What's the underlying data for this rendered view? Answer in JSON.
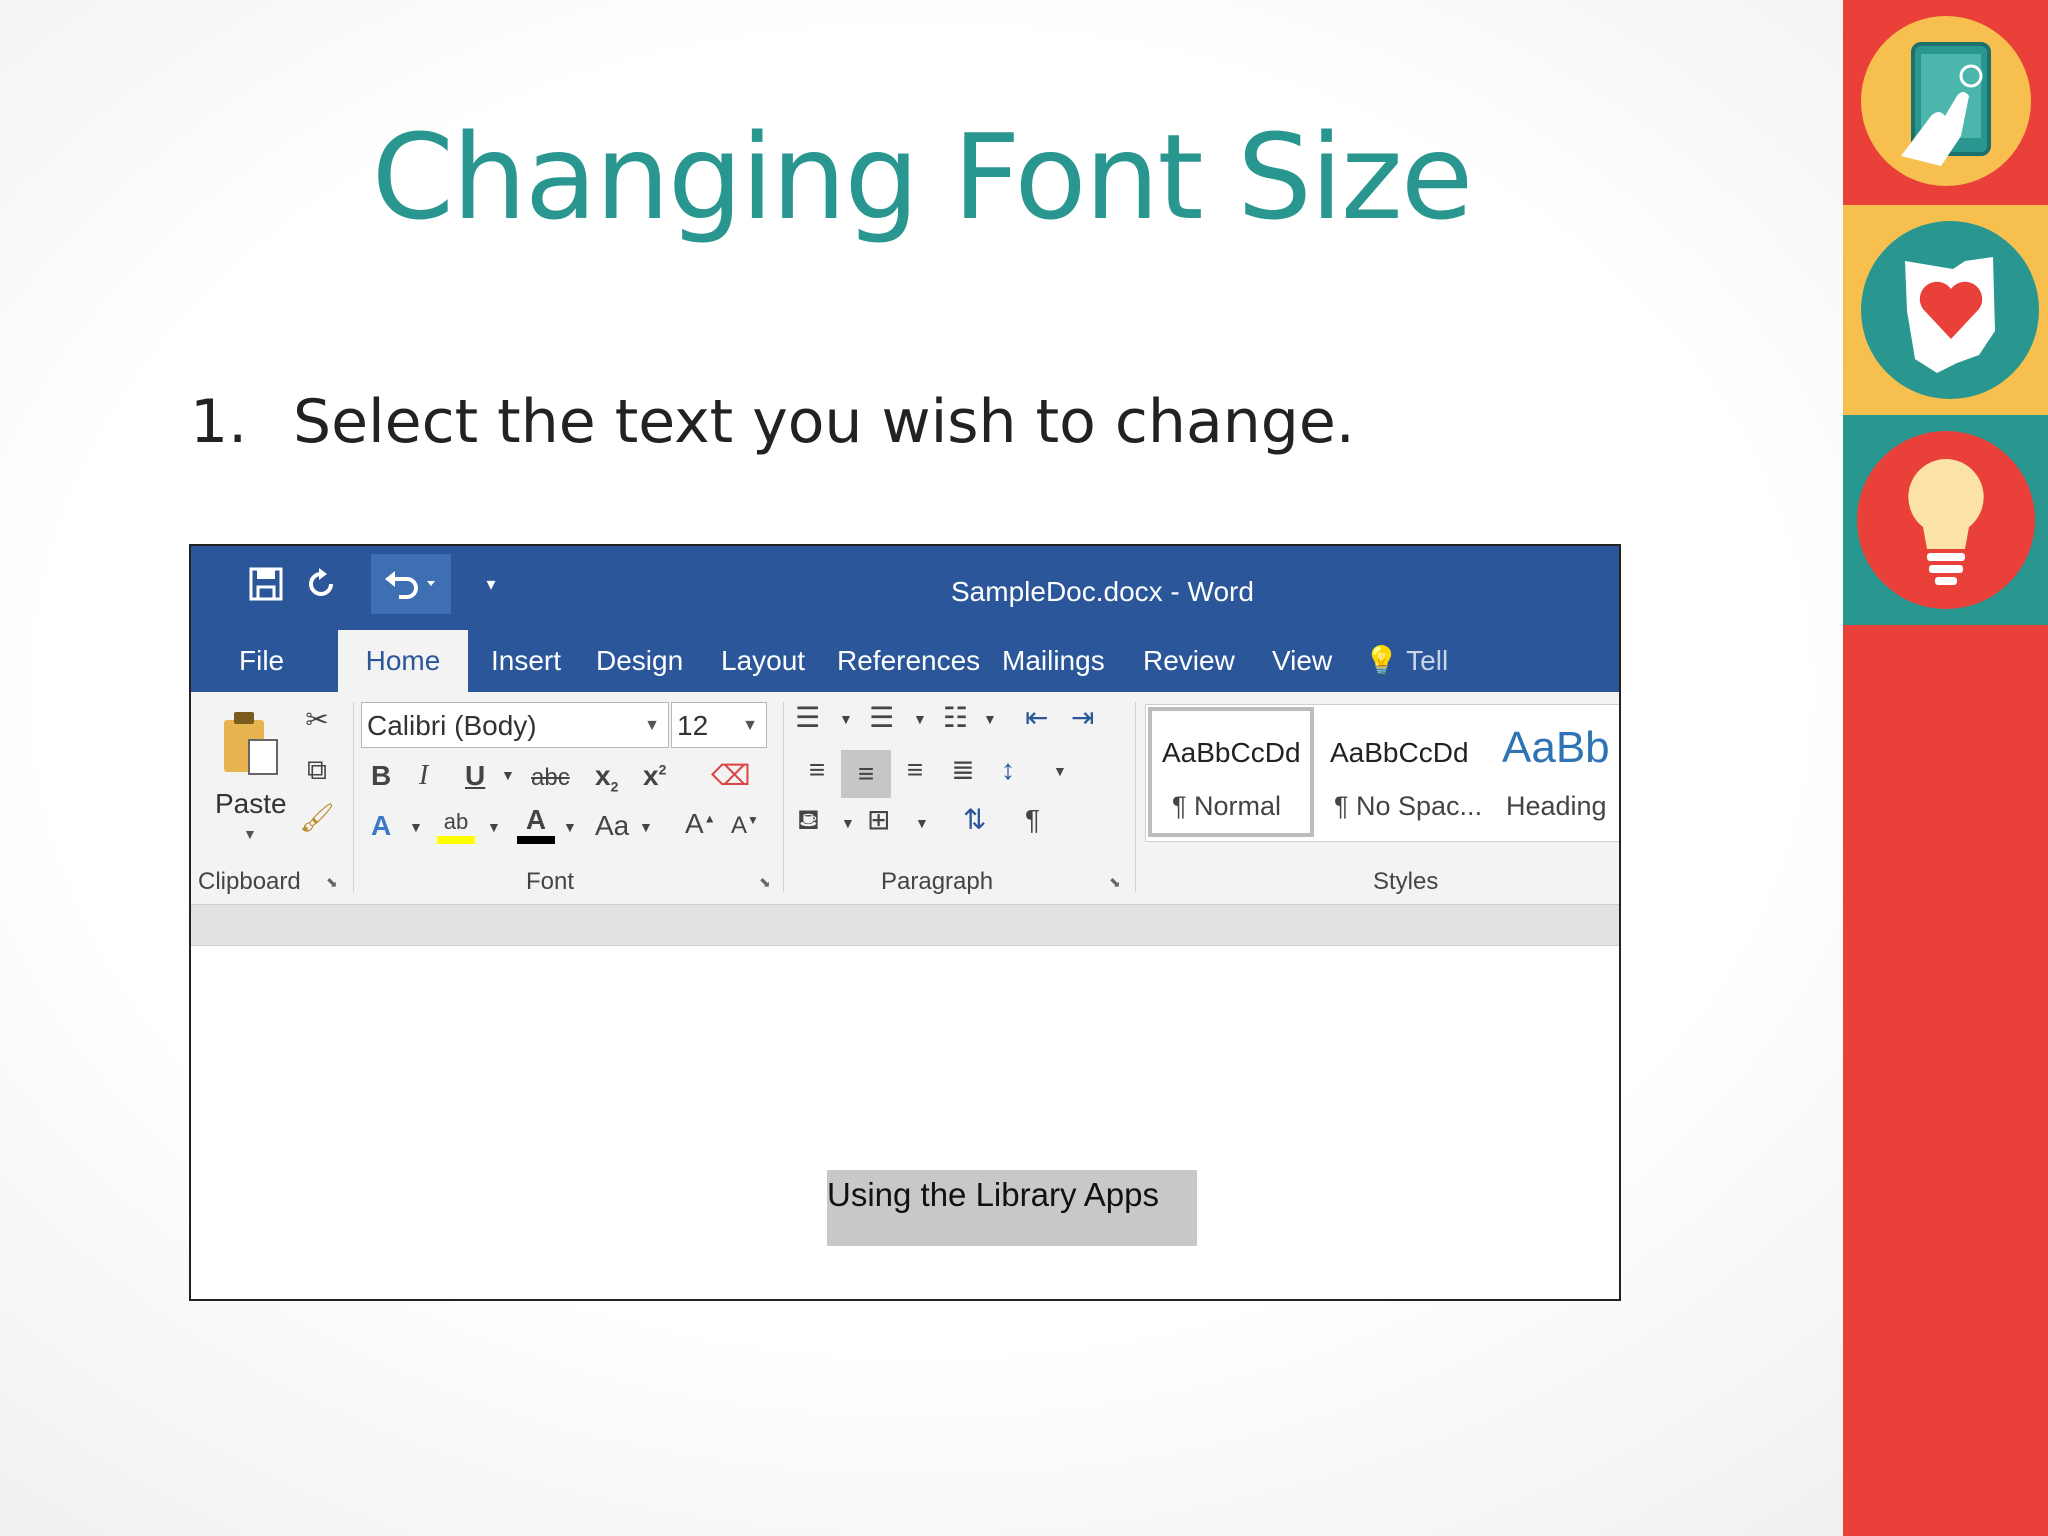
{
  "slide": {
    "title": "Changing Font Size",
    "step_number": "1.",
    "step_text": "Select the text you wish to change."
  },
  "word": {
    "window_title": "SampleDoc.docx - Word",
    "qat": {
      "save_icon": "save-icon",
      "repeat_icon": "repeat-icon",
      "undo_icon": "undo-icon"
    },
    "tabs": [
      "File",
      "Home",
      "Insert",
      "Design",
      "Layout",
      "References",
      "Mailings",
      "Review",
      "View",
      "Tell"
    ],
    "active_tab": "Home",
    "clipboard": {
      "paste_label": "Paste",
      "group_label": "Clipboard"
    },
    "font": {
      "font_name": "Calibri (Body)",
      "font_size": "12",
      "bold": "B",
      "italic": "I",
      "underline": "U",
      "strikethrough": "abc",
      "subscript": "x",
      "superscript": "x",
      "text_effects": "A",
      "highlight": "ab",
      "font_color": "A",
      "change_case": "Aa",
      "grow_font": "A",
      "shrink_font": "A",
      "group_label": "Font"
    },
    "paragraph": {
      "group_label": "Paragraph",
      "pilcrow": "¶"
    },
    "styles": {
      "group_label": "Styles",
      "items": [
        {
          "sample": "AaBbCcDd",
          "name": "¶ Normal"
        },
        {
          "sample": "AaBbCcDd",
          "name": "¶ No Spac..."
        },
        {
          "sample": "AaBb",
          "name": "Heading"
        }
      ]
    },
    "document": {
      "selected_text": "Using the Library Apps"
    },
    "colors": {
      "titlebar": "#2b579a",
      "ribbon": "#f3f3f3",
      "highlight": "#ffff00",
      "font_color_bar": "#000000"
    }
  },
  "sidebar": {
    "colors": {
      "red": "#e9403a",
      "yellow": "#f7c04e",
      "teal": "#2a9690"
    },
    "icons": [
      "tablet-touch-icon",
      "ohio-heart-icon",
      "lightbulb-icon"
    ]
  }
}
